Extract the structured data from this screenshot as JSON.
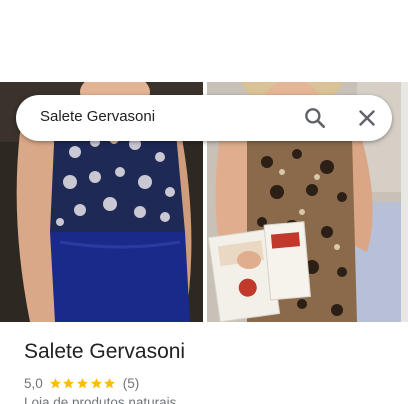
{
  "search": {
    "query": "Salete Gervasoni"
  },
  "place": {
    "name": "Salete Gervasoni",
    "rating": "5,0",
    "stars": 5,
    "review_count": "(5)",
    "category": "Loja de produtos naturais"
  },
  "icons": {
    "search": "search-icon",
    "close": "close-icon",
    "star": "star-icon"
  },
  "colors": {
    "star": "#fbbc04",
    "text_primary": "#202124",
    "text_secondary": "#70757a"
  }
}
